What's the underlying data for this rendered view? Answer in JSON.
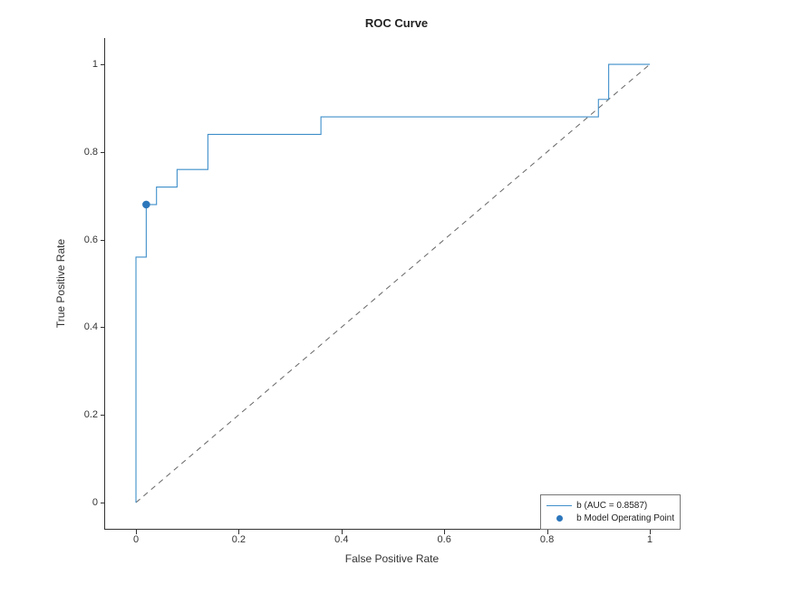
{
  "chart_data": {
    "type": "line",
    "title": "ROC Curve",
    "xlabel": "False Positive Rate",
    "ylabel": "True Positive Rate",
    "xlim": [
      -0.06,
      1.06
    ],
    "ylim": [
      -0.06,
      1.06
    ],
    "xticks": [
      0,
      0.2,
      0.4,
      0.6,
      0.8,
      1
    ],
    "yticks": [
      0,
      0.2,
      0.4,
      0.6,
      0.8,
      1
    ],
    "series": [
      {
        "name": "b (AUC = 0.8587)",
        "color": "#3f8fca",
        "x": [
          0.0,
          0.0,
          0.02,
          0.02,
          0.04,
          0.04,
          0.08,
          0.08,
          0.14,
          0.14,
          0.36,
          0.36,
          0.9,
          0.9,
          0.92,
          0.92,
          1.0,
          1.0
        ],
        "y": [
          0.0,
          0.56,
          0.56,
          0.68,
          0.68,
          0.72,
          0.72,
          0.76,
          0.76,
          0.84,
          0.84,
          0.88,
          0.88,
          0.92,
          0.92,
          1.0,
          1.0,
          1.0
        ]
      },
      {
        "name": "diagonal",
        "style": "dashed",
        "color": "#666",
        "x": [
          0,
          1
        ],
        "y": [
          0,
          1
        ]
      }
    ],
    "operating_point": {
      "name": "b Model Operating Point",
      "x": 0.02,
      "y": 0.68
    },
    "auc": 0.8587
  },
  "legend": {
    "line_label": "b (AUC = 0.8587)",
    "point_label": "b Model Operating Point"
  }
}
